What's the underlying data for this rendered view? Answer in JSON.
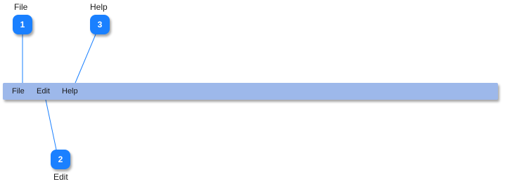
{
  "menubar": {
    "items": [
      {
        "label": "File"
      },
      {
        "label": "Edit"
      },
      {
        "label": "Help"
      }
    ]
  },
  "callouts": [
    {
      "number": "1",
      "label": "File"
    },
    {
      "number": "2",
      "label": "Edit"
    },
    {
      "number": "3",
      "label": "Help"
    }
  ],
  "colors": {
    "menubar_bg": "#9db8ea",
    "badge_bg": "#1a80ff",
    "connector": "#1a80ff"
  }
}
